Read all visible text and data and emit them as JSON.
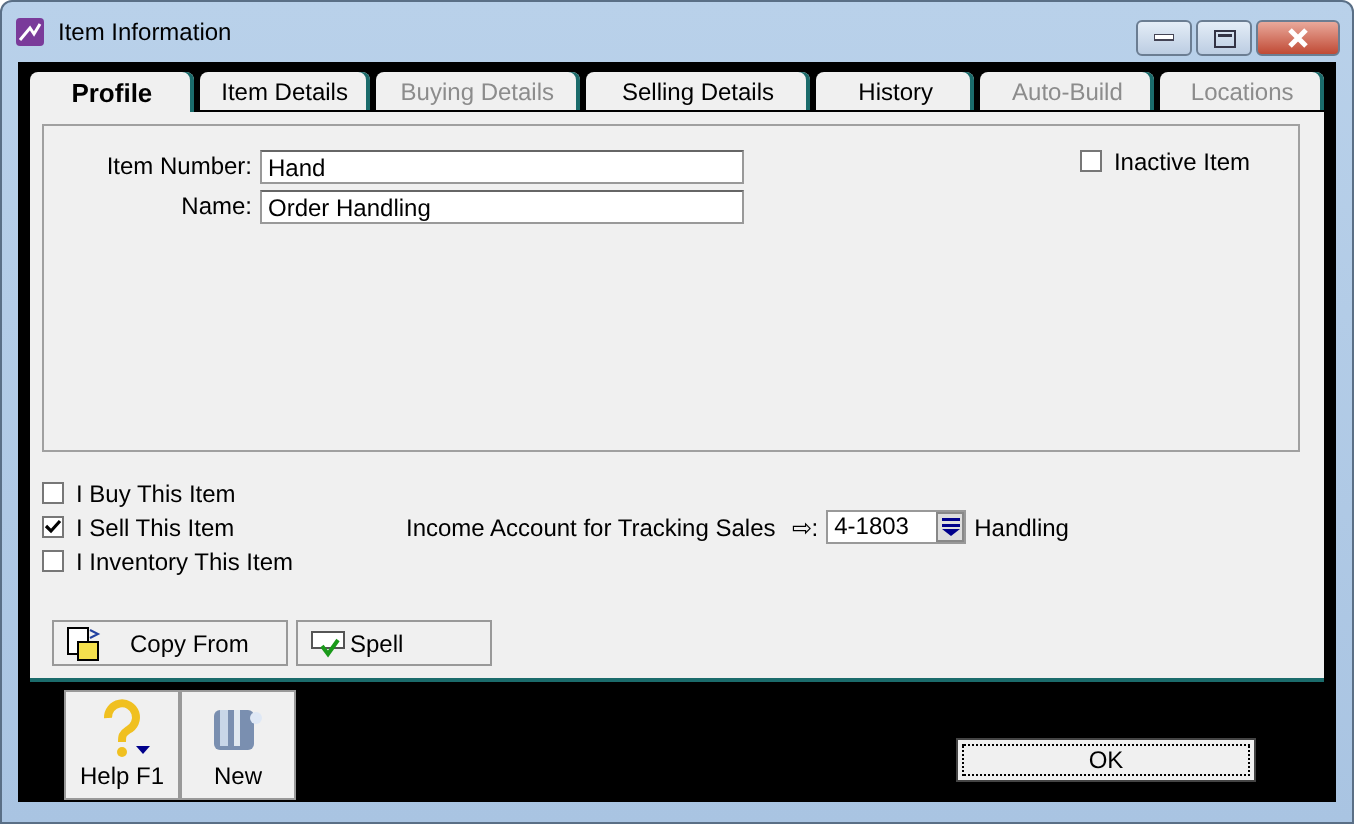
{
  "window": {
    "title": "Item Information"
  },
  "tabs": [
    {
      "label": "Profile",
      "selected": true,
      "disabled": false
    },
    {
      "label": "Item Details",
      "selected": false,
      "disabled": false
    },
    {
      "label": "Buying Details",
      "selected": false,
      "disabled": true
    },
    {
      "label": "Selling Details",
      "selected": false,
      "disabled": false
    },
    {
      "label": "History",
      "selected": false,
      "disabled": false
    },
    {
      "label": "Auto-Build",
      "selected": false,
      "disabled": true
    },
    {
      "label": "Locations",
      "selected": false,
      "disabled": true
    }
  ],
  "fields": [
    {
      "label": "Item Number:",
      "value": "Hand"
    },
    {
      "label": "Name:",
      "value": "Order Handling"
    }
  ],
  "inactive": {
    "label": "Inactive Item",
    "checked": false
  },
  "options": [
    {
      "label": "I Buy This Item",
      "checked": false
    },
    {
      "label": "I Sell This Item",
      "checked": true
    },
    {
      "label": "I Inventory This Item",
      "checked": false
    }
  ],
  "income_account": {
    "label": "Income Account for Tracking Sales",
    "arrow": "⇨",
    "colon": ":",
    "value": "4-1803",
    "account_name": "Handling"
  },
  "panel_buttons": [
    "Copy From",
    "Spell"
  ],
  "toolbar": [
    "Help F1",
    "New"
  ],
  "ok_button": "OK"
}
